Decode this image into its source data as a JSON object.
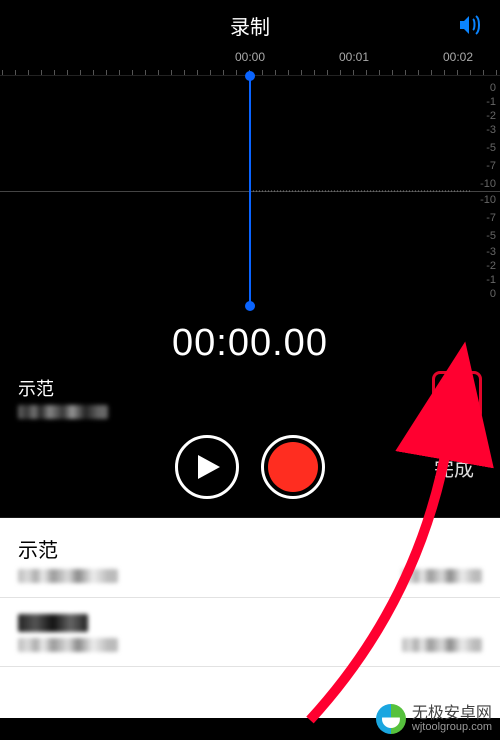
{
  "header": {
    "title": "录制"
  },
  "timeline": {
    "labels": [
      "00:00",
      "00:01",
      "00:02"
    ],
    "db_scale_top": [
      "0",
      "-1",
      "-2",
      "-3",
      "-5",
      "-7",
      "-10"
    ],
    "db_scale_bot": [
      "-10",
      "-7",
      "-5",
      "-3",
      "-2",
      "-1",
      "0"
    ]
  },
  "current_time": "00:00.00",
  "recording": {
    "name": "示范",
    "done_label": "完成"
  },
  "list": [
    {
      "title": "示范"
    },
    {
      "title": ""
    }
  ],
  "watermark": {
    "name": "无极安卓网",
    "url": "wjtoolgroup.com"
  }
}
